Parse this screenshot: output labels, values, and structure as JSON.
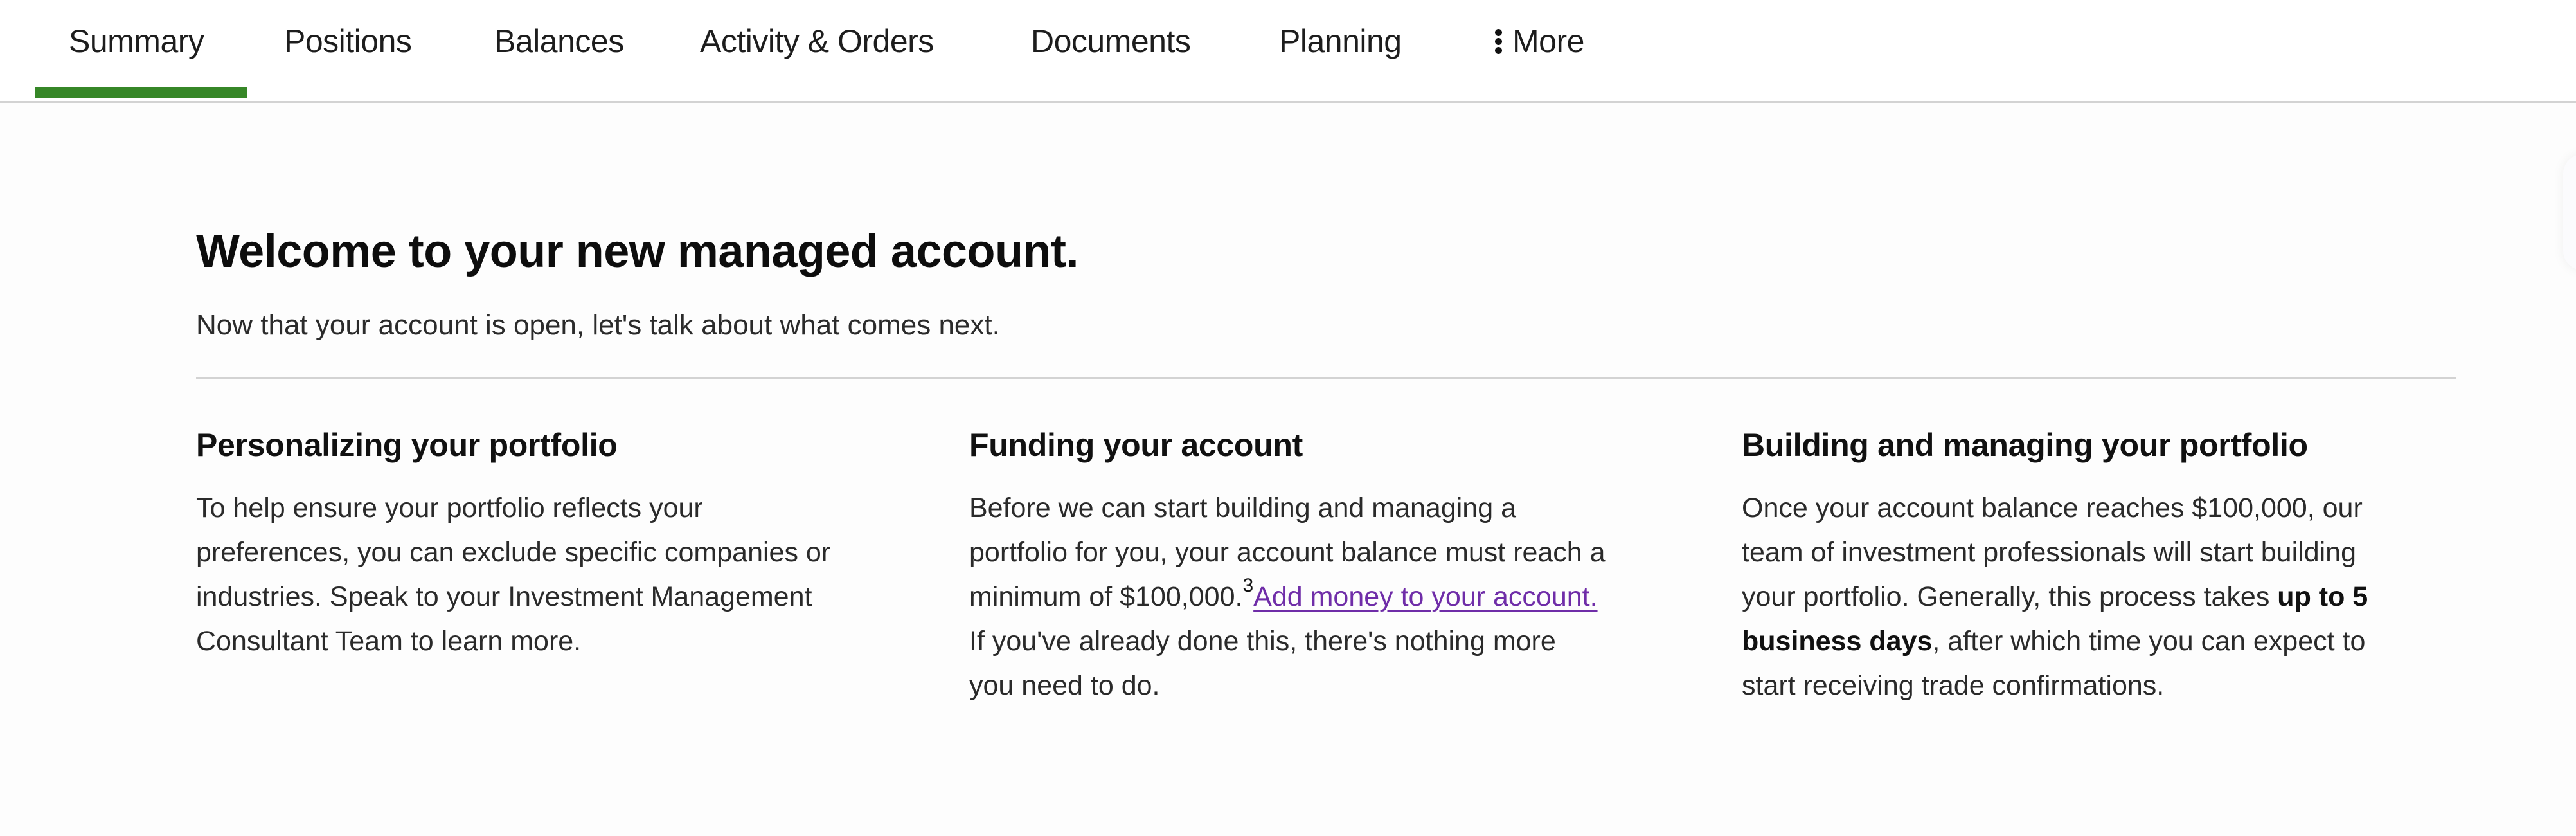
{
  "nav": {
    "tabs": [
      {
        "label": "Summary",
        "active": true
      },
      {
        "label": "Positions",
        "active": false
      },
      {
        "label": "Balances",
        "active": false
      },
      {
        "label": "Activity & Orders",
        "active": false
      },
      {
        "label": "Documents",
        "active": false
      },
      {
        "label": "Planning",
        "active": false
      }
    ],
    "more": {
      "label": "More",
      "icon": "vertical-ellipsis-icon"
    },
    "active_color": "#368727"
  },
  "main": {
    "title": "Welcome to your new managed account.",
    "subtitle": "Now that your account is open, let's talk about what comes next.",
    "columns": [
      {
        "heading": "Personalizing your portfolio",
        "lines": [
          "To help ensure your portfolio reflects your",
          "preferences, you can exclude specific companies or",
          "industries. Speak to your Investment Management",
          "Consultant Team to learn more."
        ]
      },
      {
        "heading": "Funding your account",
        "lines": [
          "Before we can start building and managing a",
          "portfolio for you, your account balance must reach a"
        ],
        "line3_text": "minimum of $100,000.",
        "footnote": "3",
        "link_label": "Add money to your account.",
        "lines_after": [
          "If you've already done this, there's nothing more",
          "you need to do."
        ],
        "link_color": "#6f2da8"
      },
      {
        "heading": "Building and managing your portfolio",
        "line1": "Once your account balance reaches $100,000, our",
        "line2": "team of investment professionals will start building",
        "line3_text": "your portfolio. Generally, this process takes ",
        "line3_bold": "up to 5",
        "line4_bold": "business days",
        "line4_text": ", after which time you can expect to",
        "line5": "start receiving trade confirmations."
      }
    ]
  }
}
